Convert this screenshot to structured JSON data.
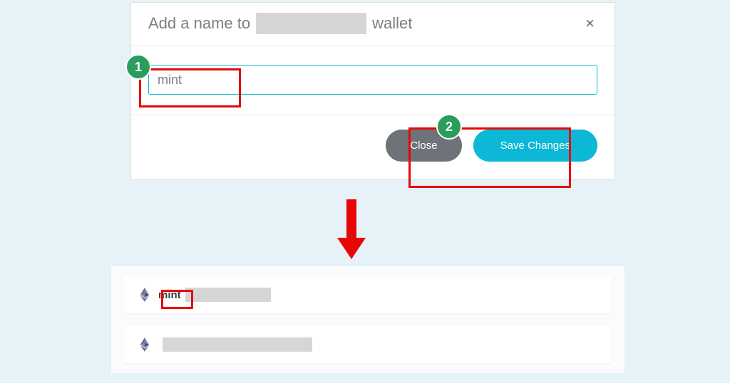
{
  "dialog": {
    "title_prefix": "Add a name to",
    "title_suffix": "wallet",
    "input_value": "mint",
    "close_label": "Close",
    "save_label": "Save Changes"
  },
  "annotations": {
    "badge1": "1",
    "badge2": "2"
  },
  "wallet_list": {
    "items": [
      {
        "name": "mint"
      },
      {
        "name": ""
      }
    ]
  }
}
